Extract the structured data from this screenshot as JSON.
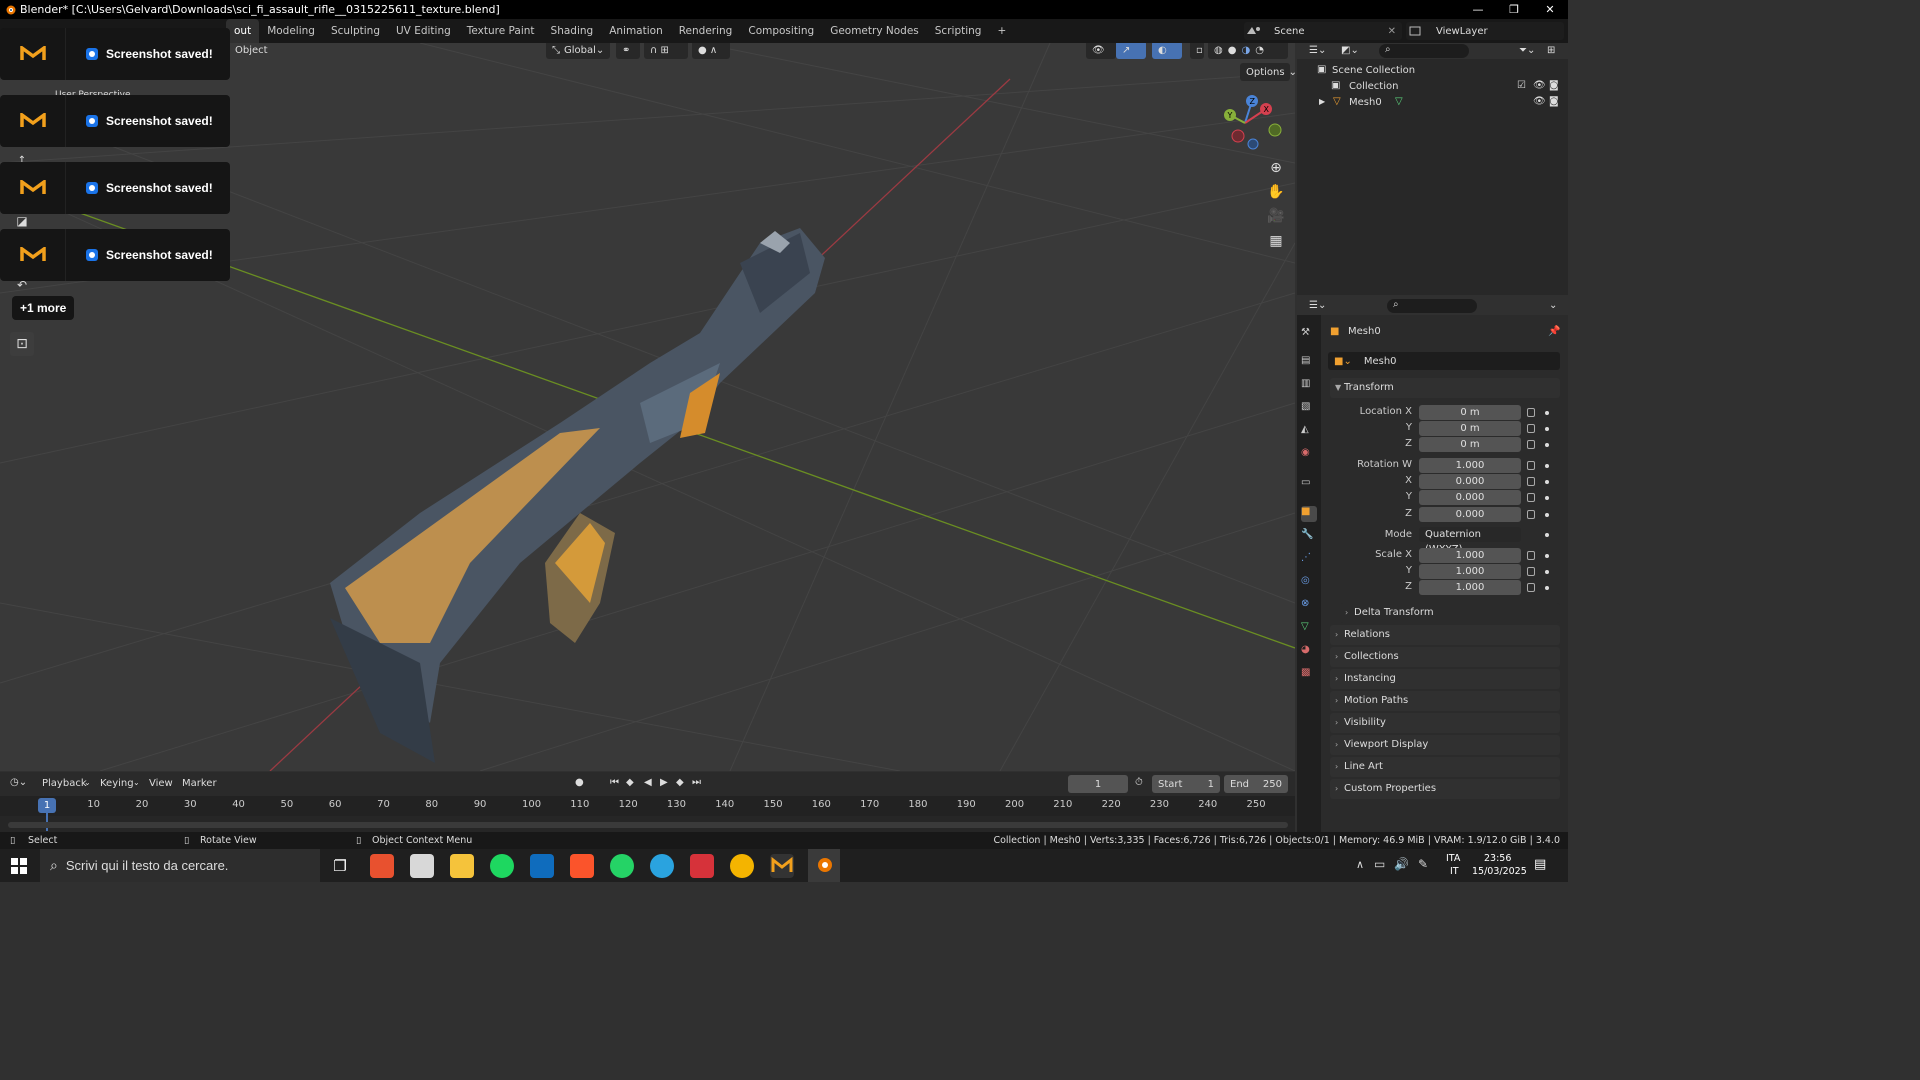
{
  "window": {
    "title": "Blender* [C:\\Users\\Gelvard\\Downloads\\sci_fi_assault_rifle__0315225611_texture.blend]",
    "min": "—",
    "max": "❐",
    "close": "✕"
  },
  "workspaces": [
    "out",
    "Modeling",
    "Sculpting",
    "UV Editing",
    "Texture Paint",
    "Shading",
    "Animation",
    "Rendering",
    "Compositing",
    "Geometry Nodes",
    "Scripting",
    "+"
  ],
  "scene": {
    "label": "Scene",
    "viewlayer": "ViewLayer"
  },
  "viewport": {
    "mode_label": "Object",
    "orientation": "Global",
    "options": "Options",
    "partial_label": "User Perspective"
  },
  "gizmo": {
    "x": "X",
    "y": "Y",
    "z": "Z"
  },
  "toasts": [
    {
      "message": "Screenshot saved!"
    },
    {
      "message": "Screenshot saved!"
    },
    {
      "message": "Screenshot saved!"
    },
    {
      "message": "Screenshot saved!"
    }
  ],
  "more": "+1 more",
  "timeline": {
    "menus": [
      "Playback",
      "Keying",
      "View",
      "Marker"
    ],
    "current": "1",
    "start_label": "Start",
    "start": "1",
    "end_label": "End",
    "end": "250",
    "ticks": [
      "10",
      "20",
      "30",
      "40",
      "50",
      "60",
      "70",
      "80",
      "90",
      "100",
      "110",
      "120",
      "130",
      "140",
      "150",
      "160",
      "170",
      "180",
      "190",
      "200",
      "210",
      "220",
      "230",
      "240",
      "250"
    ],
    "cursor": "1"
  },
  "status": {
    "select": "Select",
    "rotate": "Rotate View",
    "context": "Object Context Menu",
    "stats": "Collection | Mesh0 | Verts:3,335 | Faces:6,726 | Tris:6,726 | Objects:0/1 | Memory: 46.9 MiB | VRAM: 1.9/12.0 GiB | 3.4.0"
  },
  "outliner": {
    "root": "Scene Collection",
    "collection": "Collection",
    "mesh": "Mesh0"
  },
  "properties": {
    "object_name": "Mesh0",
    "data_name": "Mesh0",
    "transform_label": "Transform",
    "location": {
      "label": "Location X",
      "x": "0 m",
      "y": "0 m",
      "z": "0 m"
    },
    "rotation": {
      "label": "Rotation W",
      "w": "1.000",
      "x": "0.000",
      "y": "0.000",
      "z": "0.000"
    },
    "mode": {
      "label": "Mode",
      "value": "Quaternion (WXYZ)"
    },
    "scale": {
      "label": "Scale X",
      "x": "1.000",
      "y": "1.000",
      "z": "1.000"
    },
    "axis_labels": {
      "x": "X",
      "y": "Y",
      "z": "Z"
    },
    "delta": "Delta Transform",
    "panels": [
      "Relations",
      "Collections",
      "Instancing",
      "Motion Paths",
      "Visibility",
      "Viewport Display",
      "Line Art",
      "Custom Properties"
    ]
  },
  "taskbar": {
    "search": "Scrivi qui il testo da cercare.",
    "lang1": "ITA",
    "lang2": "IT",
    "time": "23:56",
    "date": "15/03/2025"
  }
}
